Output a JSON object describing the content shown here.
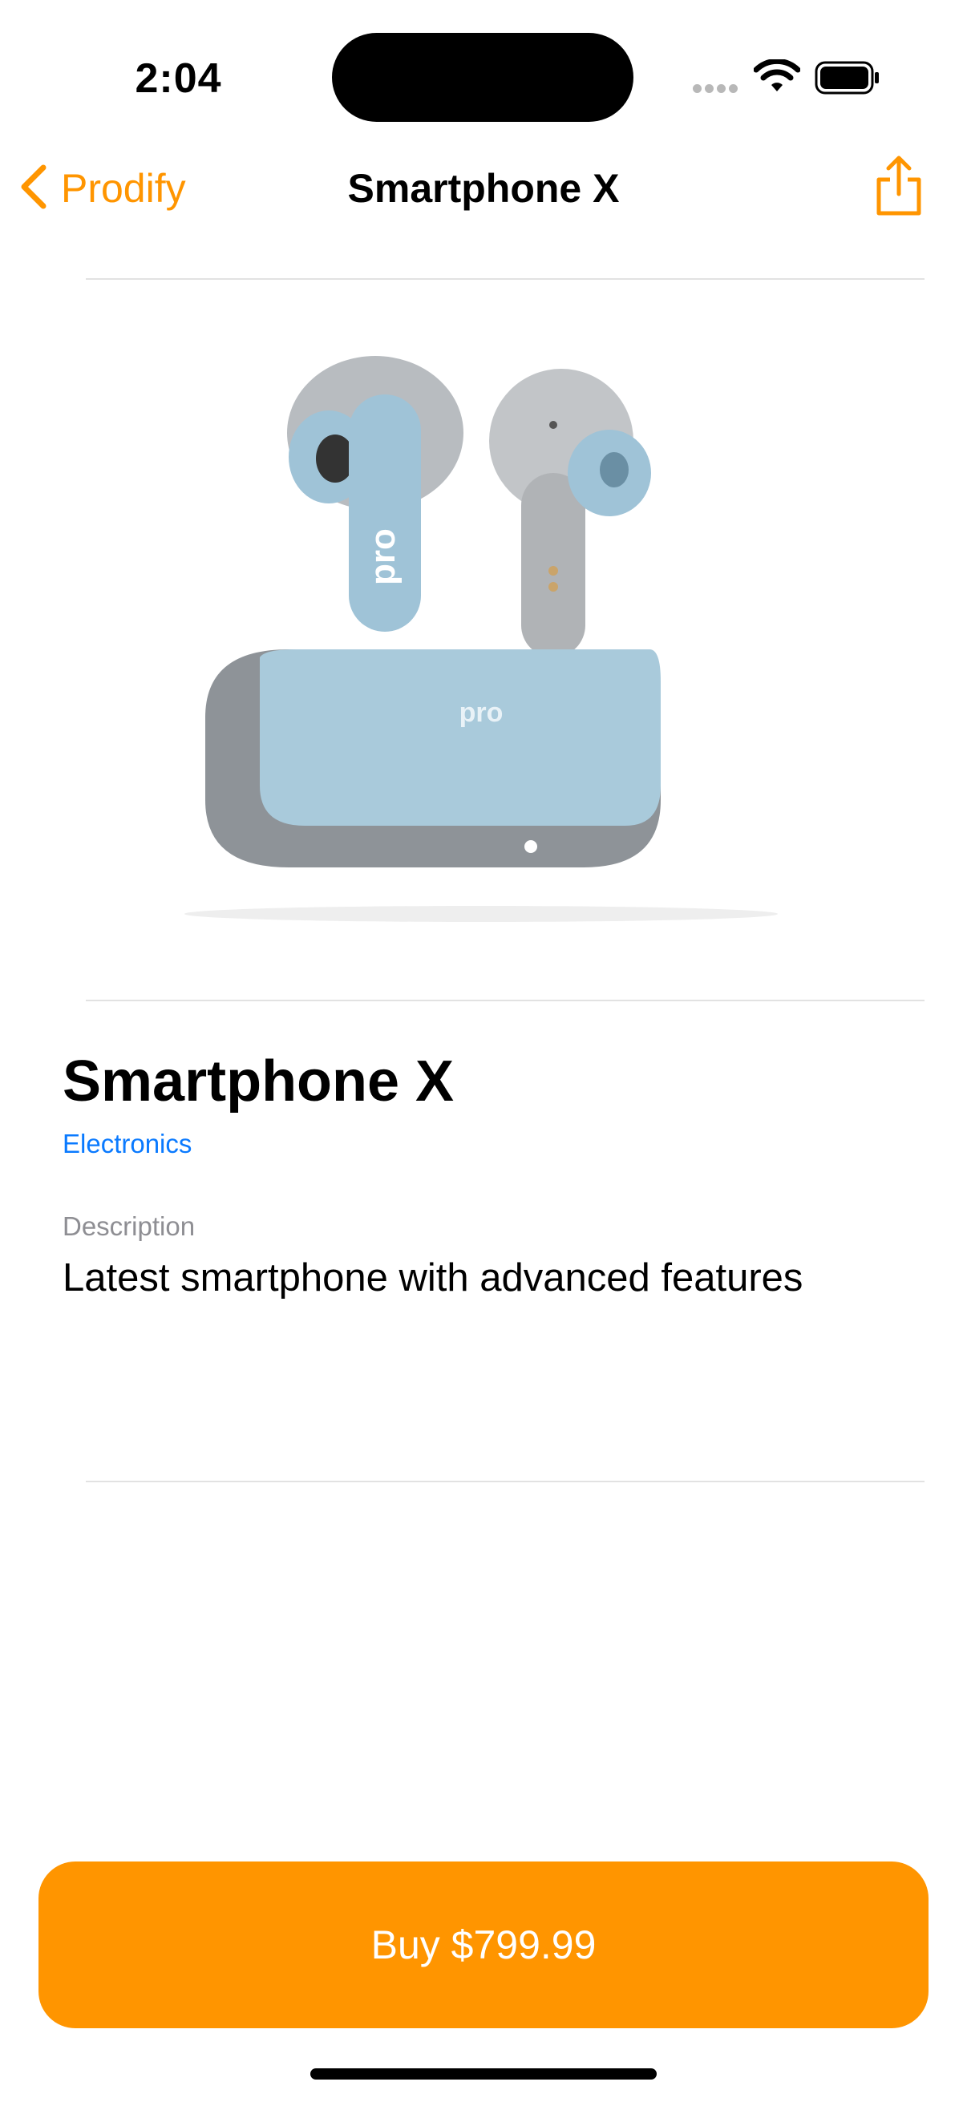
{
  "status_bar": {
    "time": "2:04"
  },
  "nav": {
    "back_label": "Prodify",
    "title": "Smartphone X"
  },
  "product": {
    "image_logo_text": "pro",
    "name": "Smartphone X",
    "category": "Electronics",
    "description_label": "Description",
    "description": "Latest smartphone with advanced features"
  },
  "buy_button": {
    "label": "Buy $799.99"
  },
  "colors": {
    "accent": "#ff9500",
    "link": "#0a7aff",
    "secondary_text": "#8e8e93"
  },
  "icons": [
    "chevron-left-icon",
    "share-icon",
    "wifi-icon",
    "battery-icon",
    "signal-icon"
  ]
}
